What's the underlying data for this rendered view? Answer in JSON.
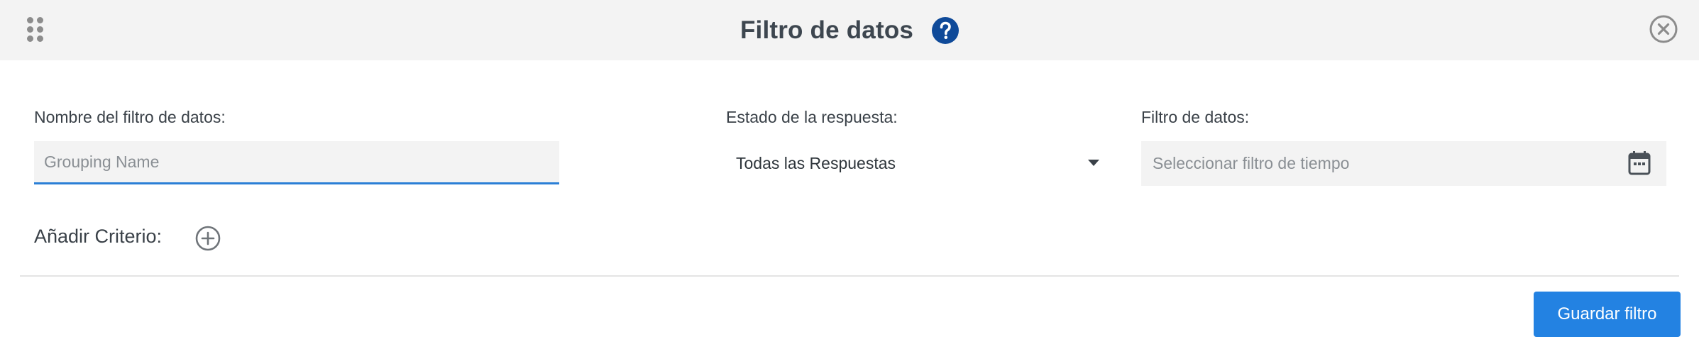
{
  "dialog": {
    "title": "Filtro de datos",
    "help_icon": "help-circle-icon",
    "close_icon": "close-circle-icon",
    "drag_icon": "drag-handle-icon"
  },
  "form": {
    "name_label": "Nombre del filtro de datos:",
    "name_placeholder": "Grouping Name",
    "name_value": "",
    "status_label": "Estado de la respuesta:",
    "status_value": "Todas las Respuestas",
    "date_label": "Filtro de datos:",
    "date_placeholder": "Seleccionar filtro de tiempo",
    "add_criteria_label": "Añadir Criterio:"
  },
  "footer": {
    "save_label": "Guardar filtro"
  },
  "colors": {
    "accent": "#2382e2",
    "help": "#0f4a99",
    "header_bg": "#f3f3f3"
  }
}
